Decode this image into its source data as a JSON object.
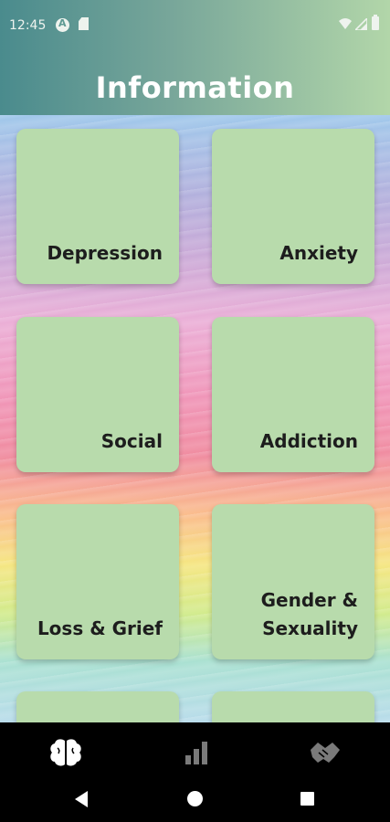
{
  "status_bar": {
    "time": "12:45",
    "icons": [
      "app-notification-icon",
      "sd-card-icon",
      "wifi-icon",
      "signal-icon",
      "battery-icon"
    ]
  },
  "header": {
    "title": "Information"
  },
  "cards": [
    {
      "label": "Depression"
    },
    {
      "label": "Anxiety"
    },
    {
      "label": "Social"
    },
    {
      "label": "Addiction"
    },
    {
      "label": "Loss & Grief"
    },
    {
      "label": "Gender &\nSexuality"
    },
    {
      "label": ""
    },
    {
      "label": ""
    }
  ],
  "bottom_nav": {
    "items": [
      {
        "icon": "brain-icon",
        "active": true
      },
      {
        "icon": "bar-chart-icon",
        "active": false
      },
      {
        "icon": "handshake-icon",
        "active": false
      }
    ]
  },
  "system_nav": {
    "icons": [
      "back-icon",
      "home-icon",
      "recents-icon"
    ]
  },
  "colors": {
    "header_start": "#4a8b8d",
    "header_end": "#b2d6a9",
    "card": "#b8dbac",
    "label": "#1d1d1d"
  }
}
